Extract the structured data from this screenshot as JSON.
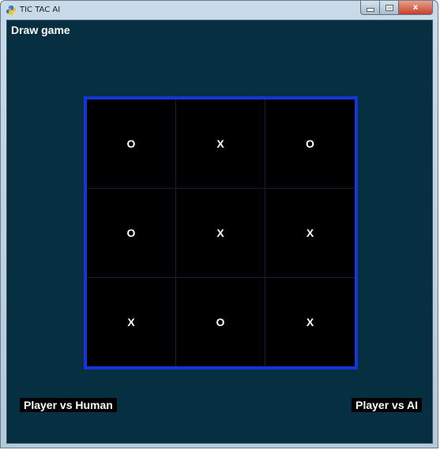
{
  "window": {
    "title": "TIC TAC AI",
    "icon": "python-snake-icon",
    "caption_buttons": [
      "minimize",
      "maximize",
      "close"
    ],
    "close_glyph": "x"
  },
  "game": {
    "status": "Draw game",
    "board": [
      [
        "O",
        "X",
        "O"
      ],
      [
        "O",
        "X",
        "X"
      ],
      [
        "X",
        "O",
        "X"
      ]
    ]
  },
  "buttons": {
    "player_vs_human": "Player vs Human",
    "player_vs_ai": "Player vs AI"
  },
  "colors": {
    "background": "#063041",
    "board_border": "#1436d8",
    "board_fill": "#000000",
    "text": "#ffffff"
  }
}
